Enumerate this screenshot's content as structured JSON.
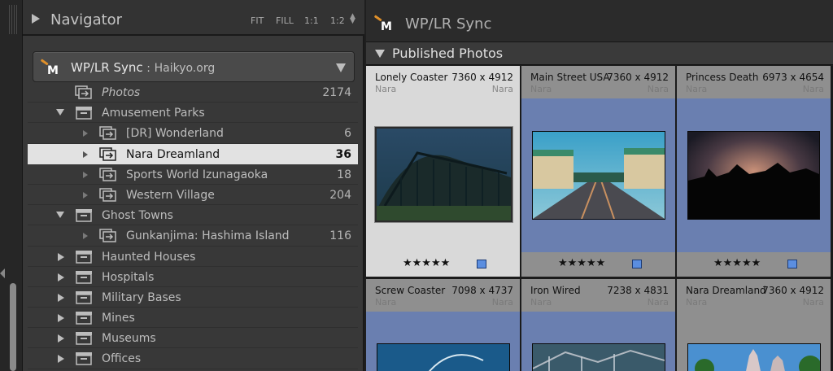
{
  "navigator": {
    "title": "Navigator",
    "zoom_options": [
      "FIT",
      "FILL",
      "1:1",
      "1:2"
    ]
  },
  "service": {
    "name": "WP/LR Sync",
    "separator": ":",
    "account": "Haikyo.org",
    "logo_letter": "M"
  },
  "collections": [
    {
      "label": "Photos",
      "count": "2174",
      "kind": "root-photos"
    },
    {
      "label": "Amusement Parks",
      "count": "",
      "kind": "set-open"
    },
    {
      "label": "[DR] Wonderland",
      "count": "6",
      "kind": "child"
    },
    {
      "label": "Nara Dreamland",
      "count": "36",
      "kind": "child",
      "selected": true
    },
    {
      "label": "Sports World Izunagaoka",
      "count": "18",
      "kind": "child"
    },
    {
      "label": "Western Village",
      "count": "204",
      "kind": "child"
    },
    {
      "label": "Ghost Towns",
      "count": "",
      "kind": "set-open"
    },
    {
      "label": "Gunkanjima: Hashima Island",
      "count": "116",
      "kind": "child"
    },
    {
      "label": "Haunted Houses",
      "count": "",
      "kind": "set-closed"
    },
    {
      "label": "Hospitals",
      "count": "",
      "kind": "set-closed"
    },
    {
      "label": "Military Bases",
      "count": "",
      "kind": "set-closed"
    },
    {
      "label": "Mines",
      "count": "",
      "kind": "set-closed"
    },
    {
      "label": "Museums",
      "count": "",
      "kind": "set-closed"
    },
    {
      "label": "Offices",
      "count": "",
      "kind": "set-closed"
    }
  ],
  "main": {
    "header_title": "WP/LR Sync",
    "logo_letter": "M",
    "section_title": "Published Photos"
  },
  "photos": [
    {
      "name": "Lonely Coaster",
      "dims": "7360 x 4912",
      "location": "Nara",
      "location2": "Nara",
      "rating": "★★★★★",
      "selected": true
    },
    {
      "name": "Main Street USA",
      "dims": "7360 x 4912",
      "location": "Nara",
      "location2": "Nara",
      "rating": "★★★★★"
    },
    {
      "name": "Princess Death",
      "dims": "6973 x 4654",
      "location": "Nara",
      "location2": "Nara",
      "rating": "★★★★★"
    },
    {
      "name": "Screw Coaster",
      "dims": "7098 x 4737",
      "location": "Nara",
      "location2": "Nara"
    },
    {
      "name": "Iron Wired",
      "dims": "7238 x 4831",
      "location": "Nara",
      "location2": "Nara"
    },
    {
      "name": "Nara Dreamland",
      "dims": "7360 x 4912",
      "location": "Nara",
      "location2": "Nara"
    }
  ],
  "colors": {
    "panel": "#383838",
    "selection": "#e2e2e2",
    "cell": "#6a7fb0",
    "cell_selected": "#d9d9d9",
    "flag": "#5b8ee0"
  },
  "icons": {
    "logo": "wplr-sync-logo",
    "collection": "published-collection-icon",
    "collection_set": "collection-set-icon"
  }
}
